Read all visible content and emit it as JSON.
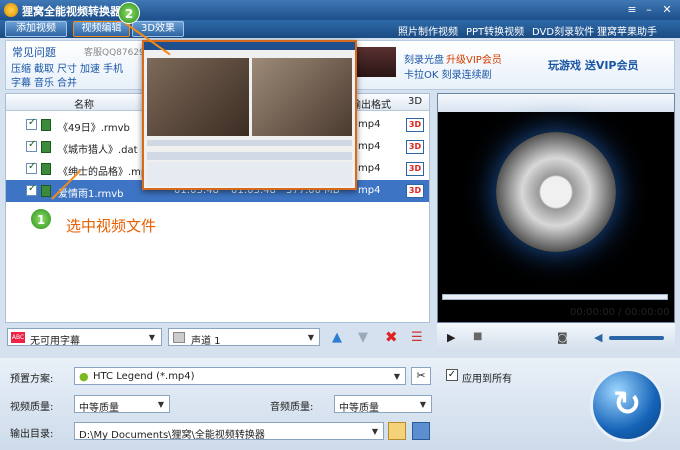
{
  "window": {
    "title": "狸窝全能视频转换器"
  },
  "toolbar": {
    "add_video": "添加视频",
    "video_edit": "视频编辑",
    "effect_3d": "3D效果",
    "links": [
      "照片制作视频",
      "PPT转换视频",
      "DVD刻录软件",
      "狸窝苹果助手"
    ]
  },
  "banner": {
    "faq_title": "常见问题",
    "qq": "客服QQ876292",
    "faq_row1": [
      "压缩",
      "截取",
      "尺寸",
      "加速",
      "手机"
    ],
    "faq_row2": [
      "字幕",
      "音乐",
      "合并"
    ],
    "promo_burn": "刻录光盘",
    "promo_vip": "升级VIP会员",
    "promo_karaoke": "卡拉OK 刻录连续剧",
    "promo_game": "玩游戏 送VIP会员"
  },
  "filelist": {
    "headers": {
      "name": "名称",
      "format": "输出格式",
      "col3d": "3D"
    },
    "rows": [
      {
        "name": "《49日》.rmvb",
        "format": "mp4",
        "selected": false
      },
      {
        "name": "《城市猎人》.dat",
        "format": "mp4",
        "selected": false
      },
      {
        "name": "《绅士的品格》.mp4",
        "format": "mp4",
        "selected": false
      },
      {
        "name": "爱情雨1.rmvb",
        "dur1": "01:03:48",
        "dur2": "01:03:48",
        "size": "377.00 MB",
        "format": "mp4",
        "selected": true
      }
    ],
    "icon_3d": "3D"
  },
  "preview": {
    "time": "00:00:00 / 00:00:00"
  },
  "subtitle": {
    "value": "无可用字幕"
  },
  "audio": {
    "value": "声道 1"
  },
  "bottom": {
    "preset_label": "预置方案:",
    "preset_value": "HTC Legend (*.mp4)",
    "apply_all": "应用到所有",
    "vq_label": "视频质量:",
    "vq_value": "中等质量",
    "aq_label": "音频质量:",
    "aq_value": "中等质量",
    "out_label": "输出目录:",
    "out_value": "D:\\My Documents\\狸窝\\全能视频转换器"
  },
  "callouts": {
    "step1_num": "1",
    "step1_text": "选中视频文件",
    "step2_num": "2"
  }
}
